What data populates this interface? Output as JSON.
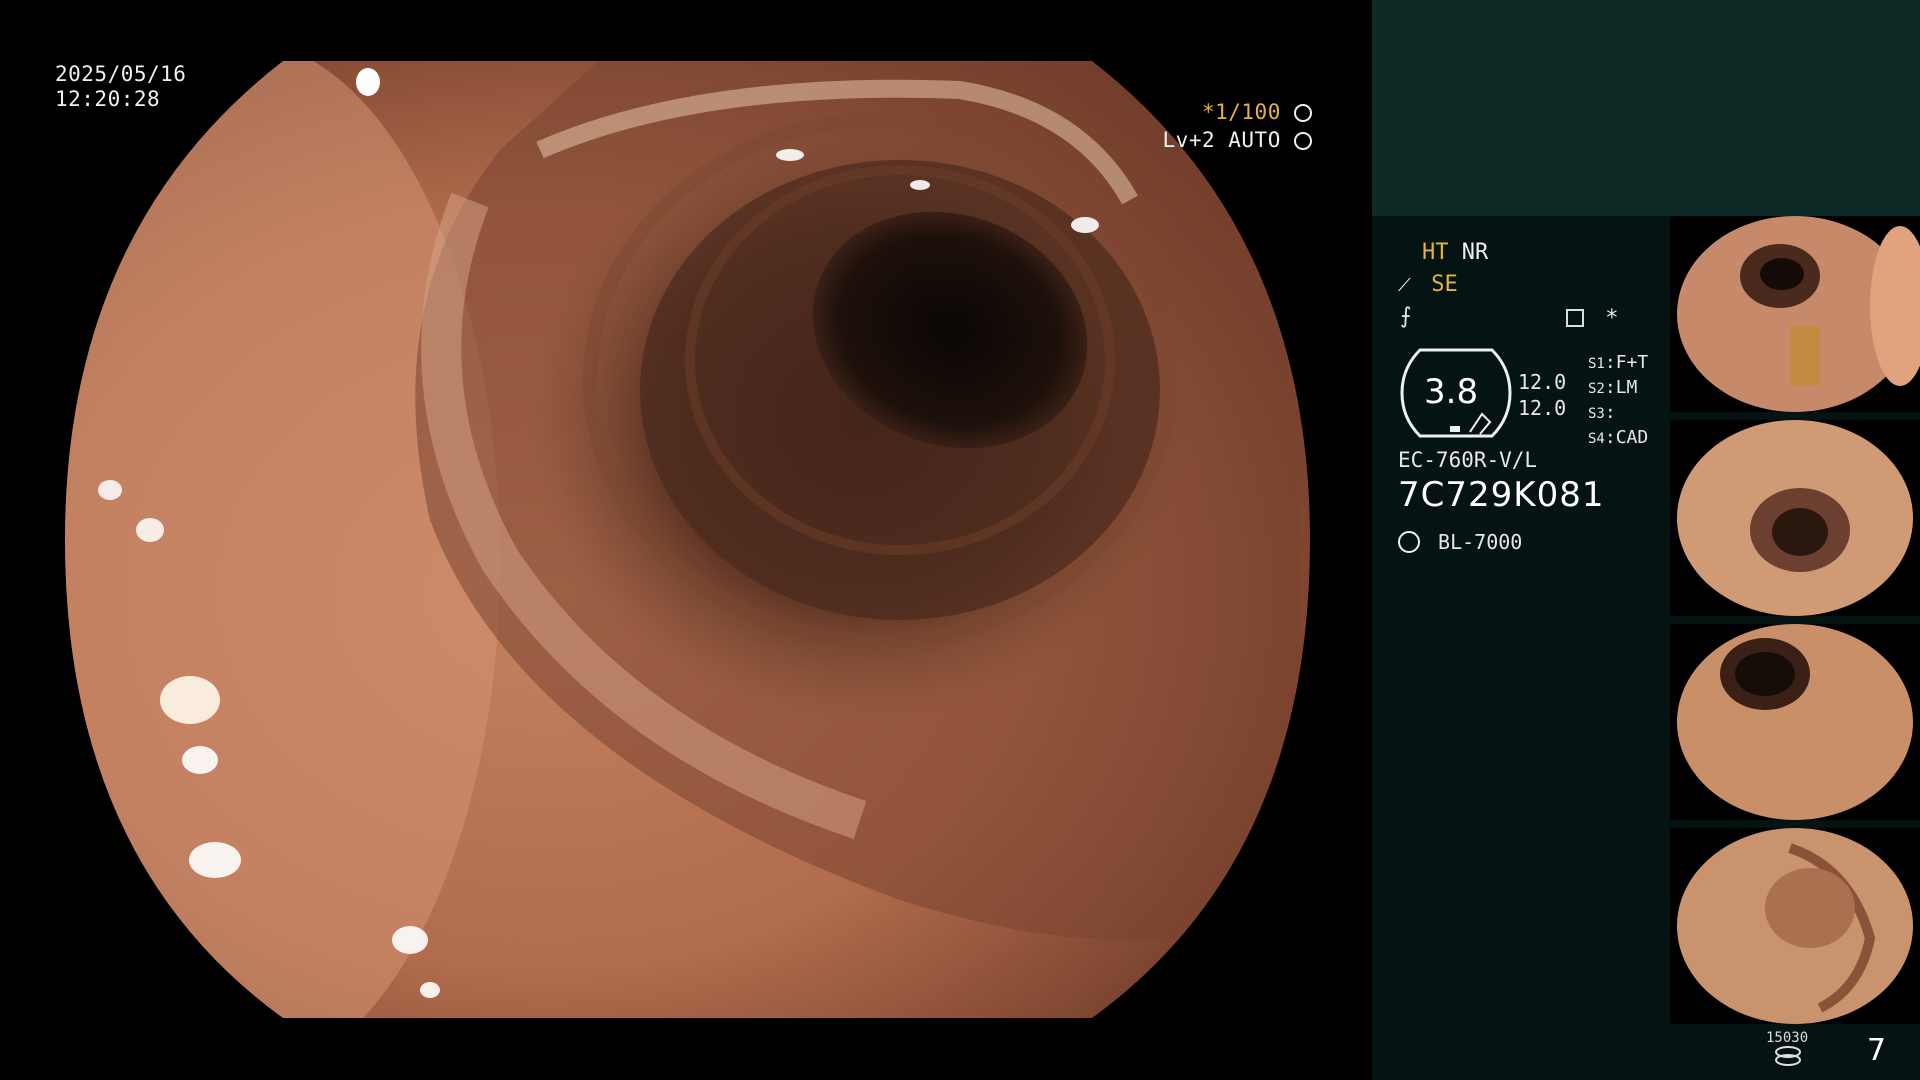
{
  "overlay": {
    "date": "2025/05/16",
    "time": "12:20:28",
    "shutter_star": "*",
    "shutter": "1/100",
    "level": "Lv+2",
    "mode": "AUTO"
  },
  "panel": {
    "ht": "HT",
    "nr": "NR",
    "se": "SE",
    "star": "*",
    "gauge_value": "3.8",
    "val1": "12.0",
    "val2": "12.0",
    "s1_label": "S1",
    "s1_value": "F+T",
    "s2_label": "S2",
    "s2_value": "LM",
    "s3_label": "S3",
    "s3_value": "",
    "s4_label": "S4",
    "s4_value": "CAD",
    "scope_model": "EC-760R-V/L",
    "serial": "7C729K081",
    "light_source": "BL-7000",
    "storage_count": "15030",
    "image_count": "7"
  },
  "thumbnails": [
    {
      "label": "captured-image-1"
    },
    {
      "label": "captured-image-2"
    },
    {
      "label": "captured-image-3"
    },
    {
      "label": "captured-image-4"
    }
  ],
  "colors": {
    "yellow": "#e8b13a",
    "panel_bg": "#051312",
    "panel_header": "#0d2a27"
  }
}
